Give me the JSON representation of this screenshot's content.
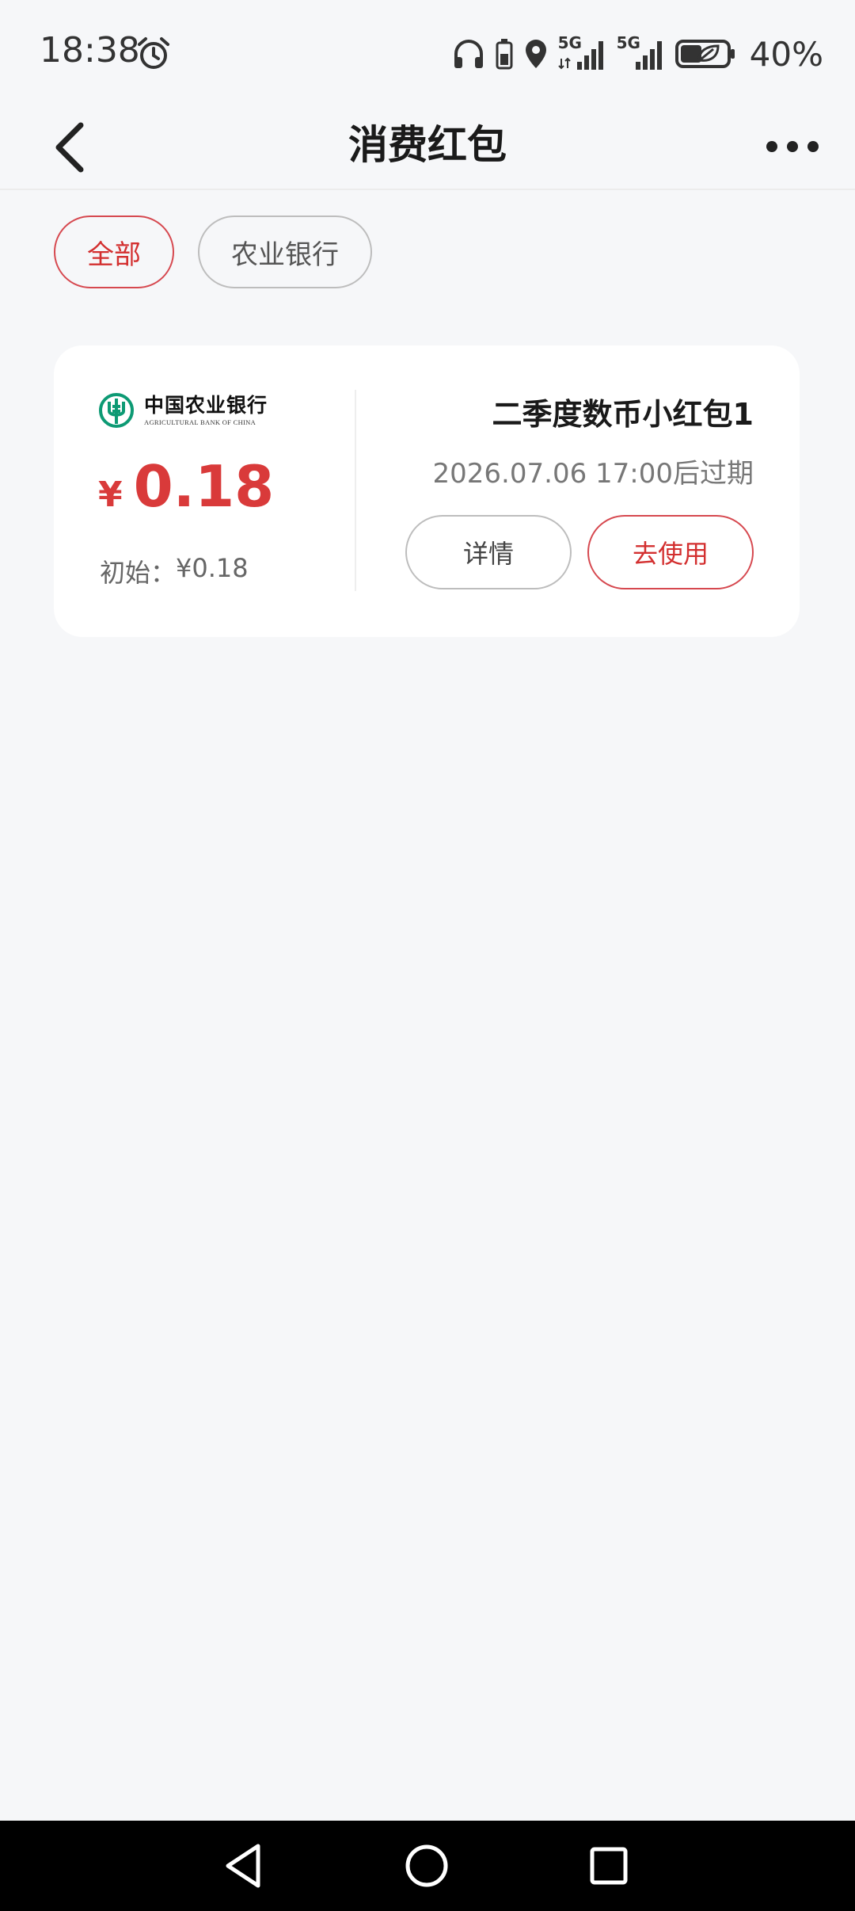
{
  "status_bar": {
    "time": "18:38",
    "network_1": "5G",
    "network_2": "5G",
    "battery": "40%",
    "icons": [
      "alarm-icon",
      "headphones-icon",
      "battery-saver-icon",
      "location-icon",
      "signal-icon",
      "signal-icon",
      "battery-icon"
    ]
  },
  "header": {
    "title": "消费红包",
    "back_icon": "chevron-left-icon",
    "more_icon": "more-horizontal-icon"
  },
  "filters": {
    "items": [
      {
        "label": "全部",
        "active": true
      },
      {
        "label": "农业银行",
        "active": false
      }
    ]
  },
  "coupon": {
    "bank_name_cn": "中国农业银行",
    "bank_name_en": "AGRICULTURAL BANK OF CHINA",
    "currency_symbol": "¥",
    "amount": "0.18",
    "initial_label": "初始：",
    "initial_value": "¥0.18",
    "title": "二季度数币小红包1",
    "expiry": "2026.07.06 17:00后过期",
    "detail_label": "详情",
    "use_label": "去使用"
  },
  "colors": {
    "accent": "#d32f2f",
    "background": "#f6f7f9",
    "bank_green": "#0d9a74"
  },
  "nav_bar": {
    "icons": [
      "nav-back-icon",
      "nav-home-icon",
      "nav-recent-icon"
    ]
  }
}
